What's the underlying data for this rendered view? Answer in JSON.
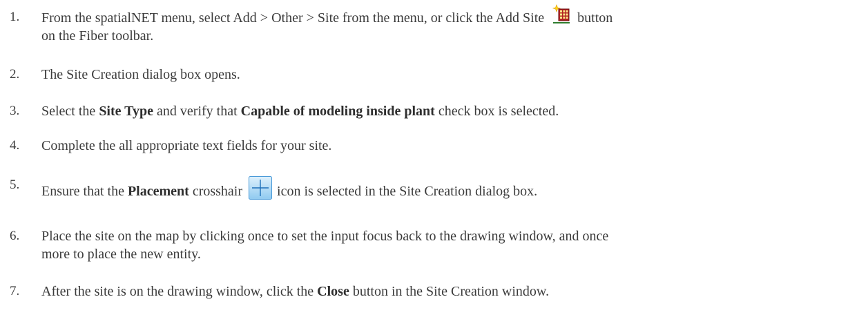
{
  "steps": [
    {
      "number": "1.",
      "part1": "From the spatialNET menu, select Add > Other > Site from the menu, or click the Add Site",
      "icon": "add-site-icon",
      "part2": "button",
      "part3": "on the Fiber toolbar."
    },
    {
      "number": "2.",
      "text": "The Site Creation dialog box opens."
    },
    {
      "number": "3.",
      "pre": "Select the",
      "bold1": "Site Type",
      "mid": "and verify that",
      "bold2": "Capable of modeling inside plant",
      "post": "check box is selected."
    },
    {
      "number": "4.",
      "text": "Complete the all appropriate text fields for your site."
    },
    {
      "number": "5.",
      "pre": "Ensure that the",
      "bold": "Placement",
      "mid": "crosshair",
      "icon": "crosshair-icon",
      "post": "icon is selected in the Site Creation dialog box."
    },
    {
      "number": "6.",
      "line1": "Place the site on the map by clicking once to set the input focus back to the drawing window, and once",
      "line2": "more to place the new entity."
    },
    {
      "number": "7.",
      "pre": "After the site is on the drawing window, click the",
      "bold": "Close",
      "post": "button in the Site Creation window."
    }
  ]
}
